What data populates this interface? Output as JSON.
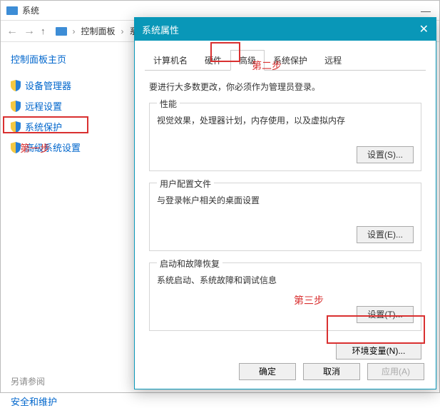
{
  "bg": {
    "title": "系统",
    "min": "—",
    "crumbs": {
      "c1": "控制面板",
      "c2": "系",
      "sep": "›"
    },
    "home": "控制面板主页",
    "links": [
      {
        "label": "设备管理器"
      },
      {
        "label": "远程设置"
      },
      {
        "label": "系统保护"
      },
      {
        "label": "高级系统设置"
      }
    ],
    "seealso": "另请参阅",
    "support": "安全和维护"
  },
  "annotations": {
    "step1": "第一步",
    "step2": "第二步",
    "step3": "第三步"
  },
  "dialog": {
    "title": "系统属性",
    "close": "✕",
    "tabs": [
      {
        "label": "计算机名"
      },
      {
        "label": "硬件"
      },
      {
        "label": "高级",
        "active": true
      },
      {
        "label": "系统保护"
      },
      {
        "label": "远程"
      }
    ],
    "notice": "要进行大多数更改，你必须作为管理员登录。",
    "groups": {
      "perf": {
        "legend": "性能",
        "desc": "视觉效果，处理器计划，内存使用，以及虚拟内存",
        "btn": "设置(S)..."
      },
      "profile": {
        "legend": "用户配置文件",
        "desc": "与登录帐户相关的桌面设置",
        "btn": "设置(E)..."
      },
      "startup": {
        "legend": "启动和故障恢复",
        "desc": "系统启动、系统故障和调试信息",
        "btn": "设置(T)..."
      }
    },
    "env_btn": "环境变量(N)...",
    "footer": {
      "ok": "确定",
      "cancel": "取消",
      "apply": "应用(A)"
    }
  }
}
